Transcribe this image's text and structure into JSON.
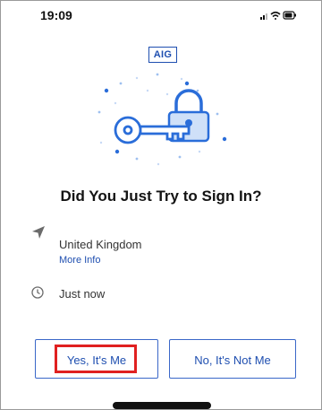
{
  "status_bar": {
    "time": "19:09",
    "icons": [
      "signal-icon",
      "wifi-icon",
      "battery-icon"
    ]
  },
  "app": {
    "logo_text": "AIG"
  },
  "hero": {
    "icon": "key-and-padlock-illustration",
    "accent_color": "#2a6dd9"
  },
  "prompt": {
    "title": "Did You Just Try to Sign In?"
  },
  "details": {
    "location_icon": "location-arrow-icon",
    "location": "United Kingdom",
    "more_info_label": "More Info",
    "time_icon": "clock-icon",
    "time": "Just now"
  },
  "actions": {
    "yes_label": "Yes, It's Me",
    "no_label": "No, It's Not Me",
    "highlight_color": "#e02020"
  }
}
